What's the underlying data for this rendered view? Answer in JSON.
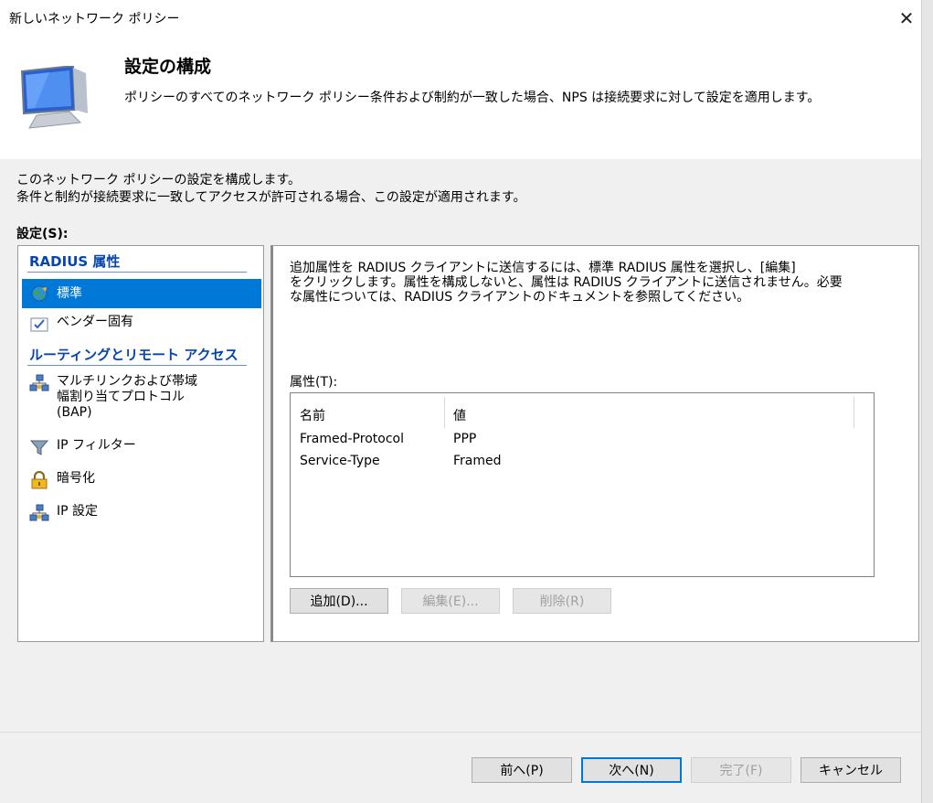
{
  "window": {
    "title": "新しいネットワーク ポリシー",
    "close_icon": "close-icon"
  },
  "header": {
    "title": "設定の構成",
    "subtitle": "ポリシーのすべてのネットワーク ポリシー条件および制約が一致した場合、NPS は接続要求に対して設定を適用します。",
    "icon": "monitor-icon"
  },
  "intro": {
    "line1": "このネットワーク ポリシーの設定を構成します。",
    "line2": "条件と制約が接続要求に一致してアクセスが許可される場合、この設定が適用されます。"
  },
  "settings_label": "設定(S):",
  "nav": {
    "section_radius": "RADIUS 属性",
    "section_routing": "ルーティングとリモート アクセス",
    "items": [
      {
        "label": "標準",
        "icon": "globe-icon",
        "selected": true
      },
      {
        "label": "ベンダー固有",
        "icon": "checkbox-icon",
        "selected": false
      },
      {
        "label": "マルチリンクおよび帯域\n幅割り当てプロトコル\n(BAP)",
        "icon": "network-icon",
        "selected": false
      },
      {
        "label": "IP フィルター",
        "icon": "filter-icon",
        "selected": false
      },
      {
        "label": "暗号化",
        "icon": "lock-icon",
        "selected": false
      },
      {
        "label": "IP 設定",
        "icon": "network-icon",
        "selected": false
      }
    ]
  },
  "content": {
    "desc_line1": "追加属性を RADIUS クライアントに送信するには、標準 RADIUS 属性を選択し、[編集]",
    "desc_line2": "をクリックします。属性を構成しないと、属性は RADIUS クライアントに送信されません。必要",
    "desc_line3": "な属性については、RADIUS クライアントのドキュメントを参照してください。",
    "attr_label": "属性(T):",
    "columns": [
      "名前",
      "値"
    ],
    "rows": [
      {
        "name": "Framed-Protocol",
        "value": "PPP"
      },
      {
        "name": "Service-Type",
        "value": "Framed"
      }
    ],
    "add_label": "追加(D)...",
    "edit_label": "編集(E)...",
    "delete_label": "削除(R)"
  },
  "footer": {
    "prev_label": "前へ(P)",
    "next_label": "次へ(N)",
    "finish_label": "完了(F)",
    "cancel_label": "キャンセル"
  },
  "colors": {
    "selection": "#0078d7",
    "section_link": "#0645ad"
  }
}
